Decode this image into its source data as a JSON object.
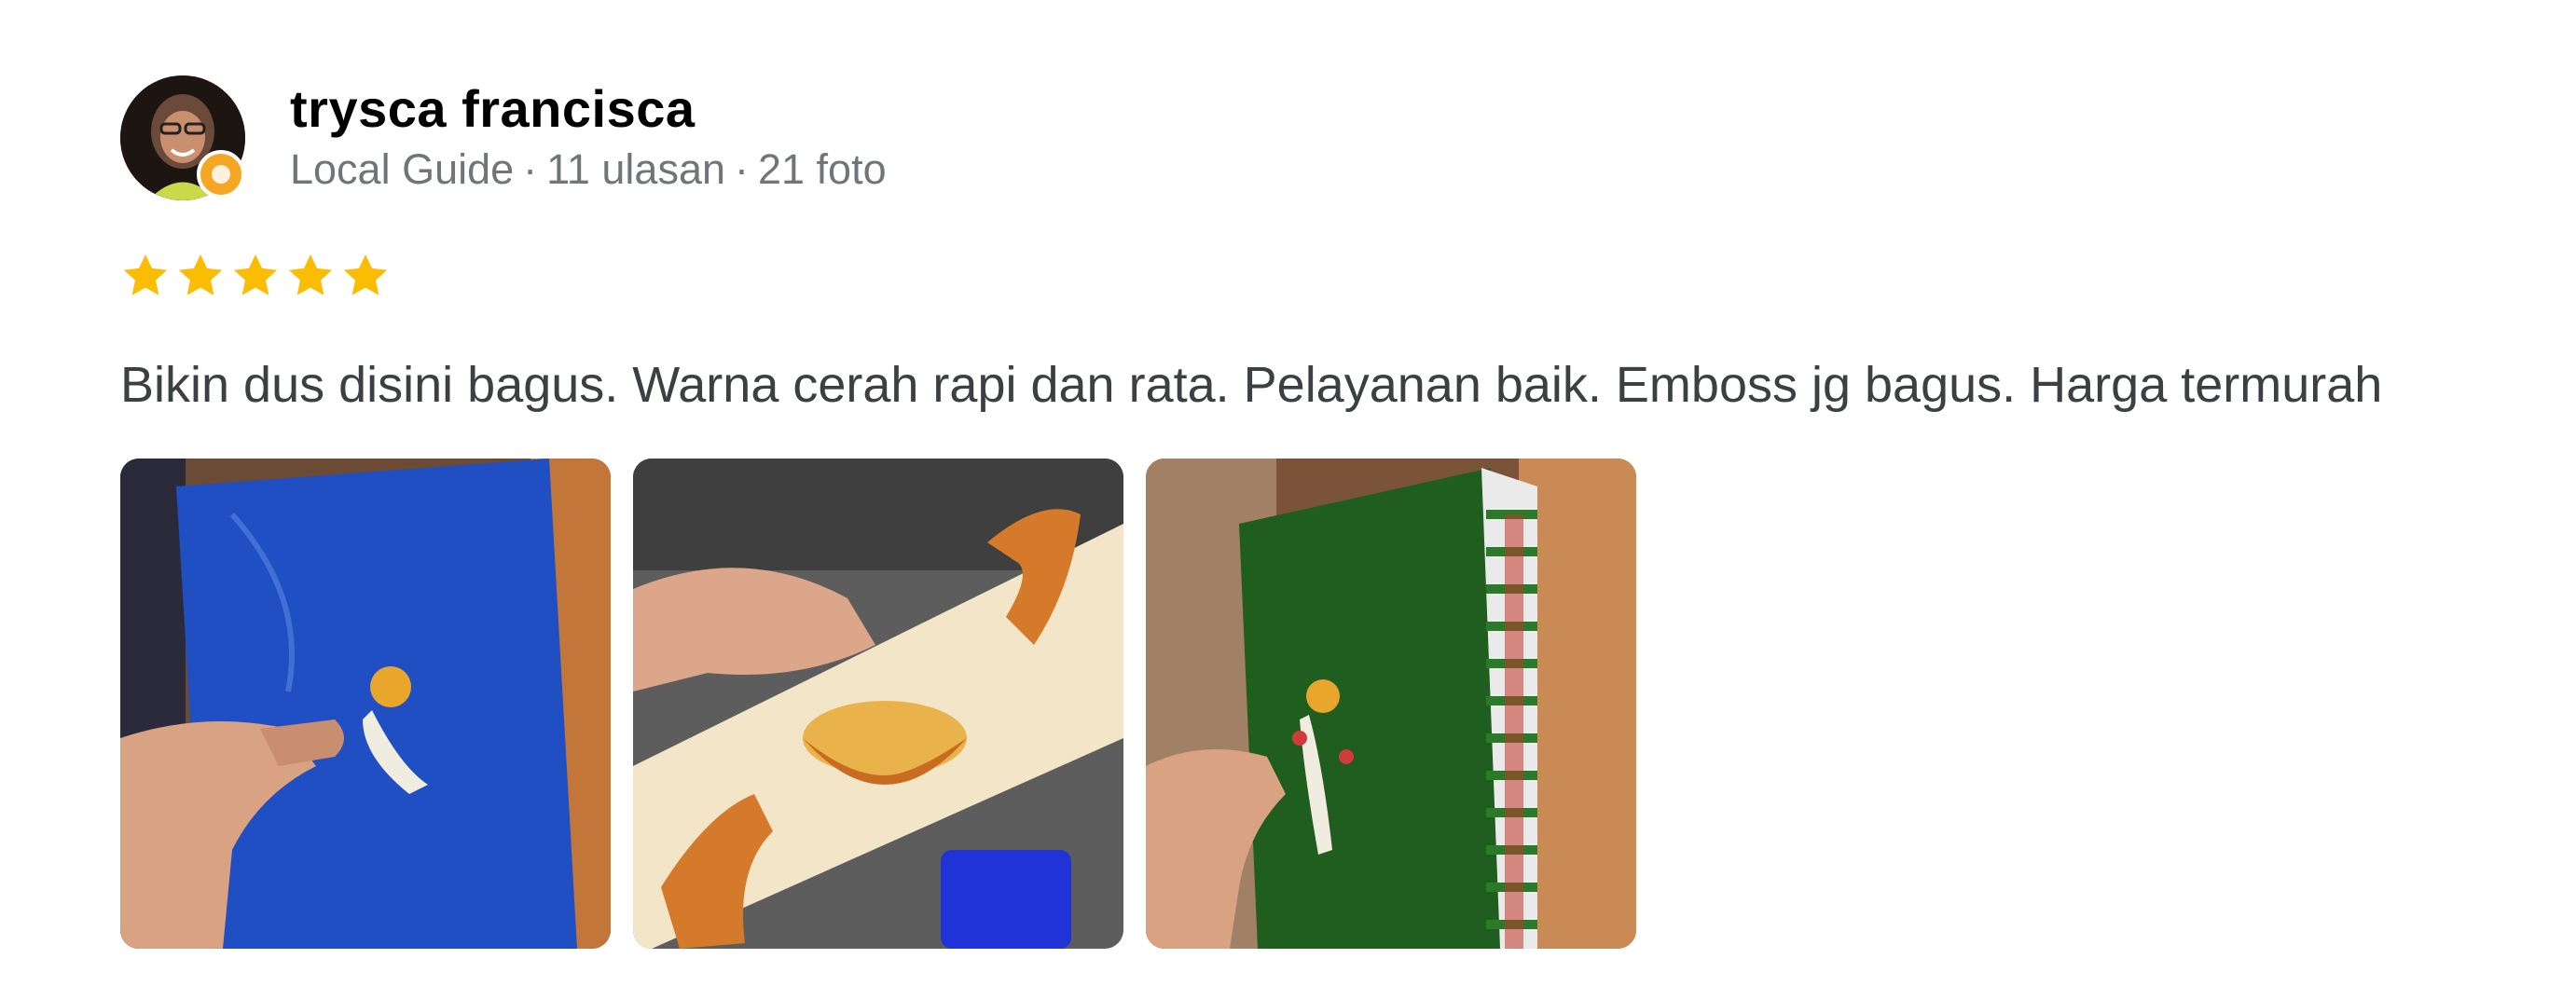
{
  "review": {
    "author_name": "trysca francisca",
    "author_badge": "Local Guide",
    "review_count": "11 ulasan",
    "photo_count": "21 foto",
    "separator": "·",
    "rating": 5,
    "rating_max": 5,
    "star_color": "#fbbc04",
    "text": "Bikin dus disini bagus. Warna cerah rapi dan rata. Pelayanan baik. Emboss jg bagus. Harga termurah",
    "photos": [
      {
        "icon": "blue-box-photo"
      },
      {
        "icon": "cream-box-photo"
      },
      {
        "icon": "green-box-photo"
      }
    ]
  },
  "colors": {
    "name": "#000000",
    "meta": "#70757a",
    "text": "#3c4043"
  }
}
